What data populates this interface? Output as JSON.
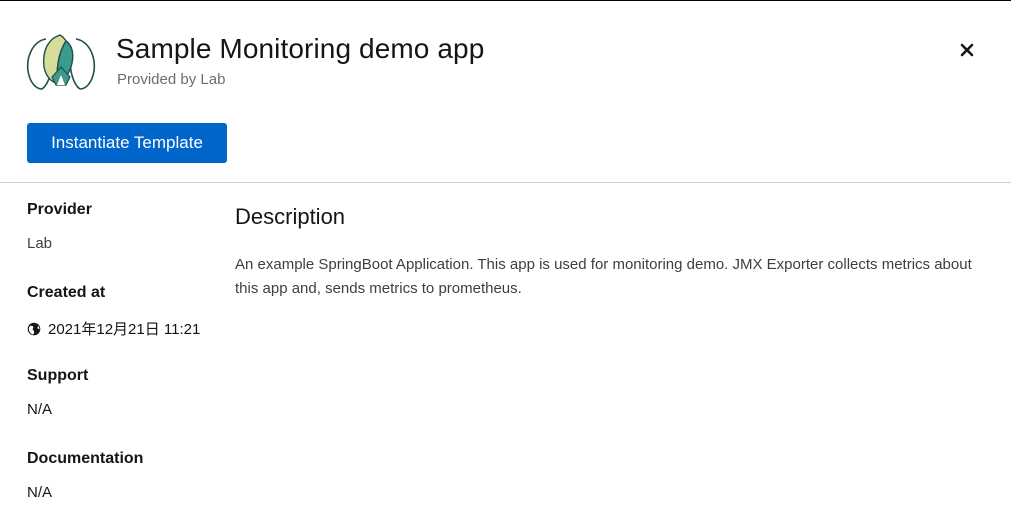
{
  "header": {
    "title": "Sample Monitoring demo app",
    "subtitle": "Provided by Lab",
    "logo_icon": "template-app-logo-icon",
    "close_icon": "close-icon",
    "instantiate_label": "Instantiate Template"
  },
  "properties": [
    {
      "label": "Provider",
      "value": "Lab"
    },
    {
      "label": "Created at",
      "value": "2021年12月21日 11:21",
      "icon": "globe-icon"
    },
    {
      "label": "Support",
      "value": "N/A"
    },
    {
      "label": "Documentation",
      "value": "N/A"
    }
  ],
  "description": {
    "heading": "Description",
    "text": "An example SpringBoot Application. This app is used for monitoring demo. JMX Exporter collects metrics about this app and, sends metrics to prometheus."
  },
  "colors": {
    "primary": "#0066cc",
    "divider": "#d2d2d2",
    "muted_text": "#6a6e73",
    "logo_teal": "#3a9b8c",
    "logo_yellow": "#d6dc9a",
    "logo_outline": "#1f4f4a"
  }
}
